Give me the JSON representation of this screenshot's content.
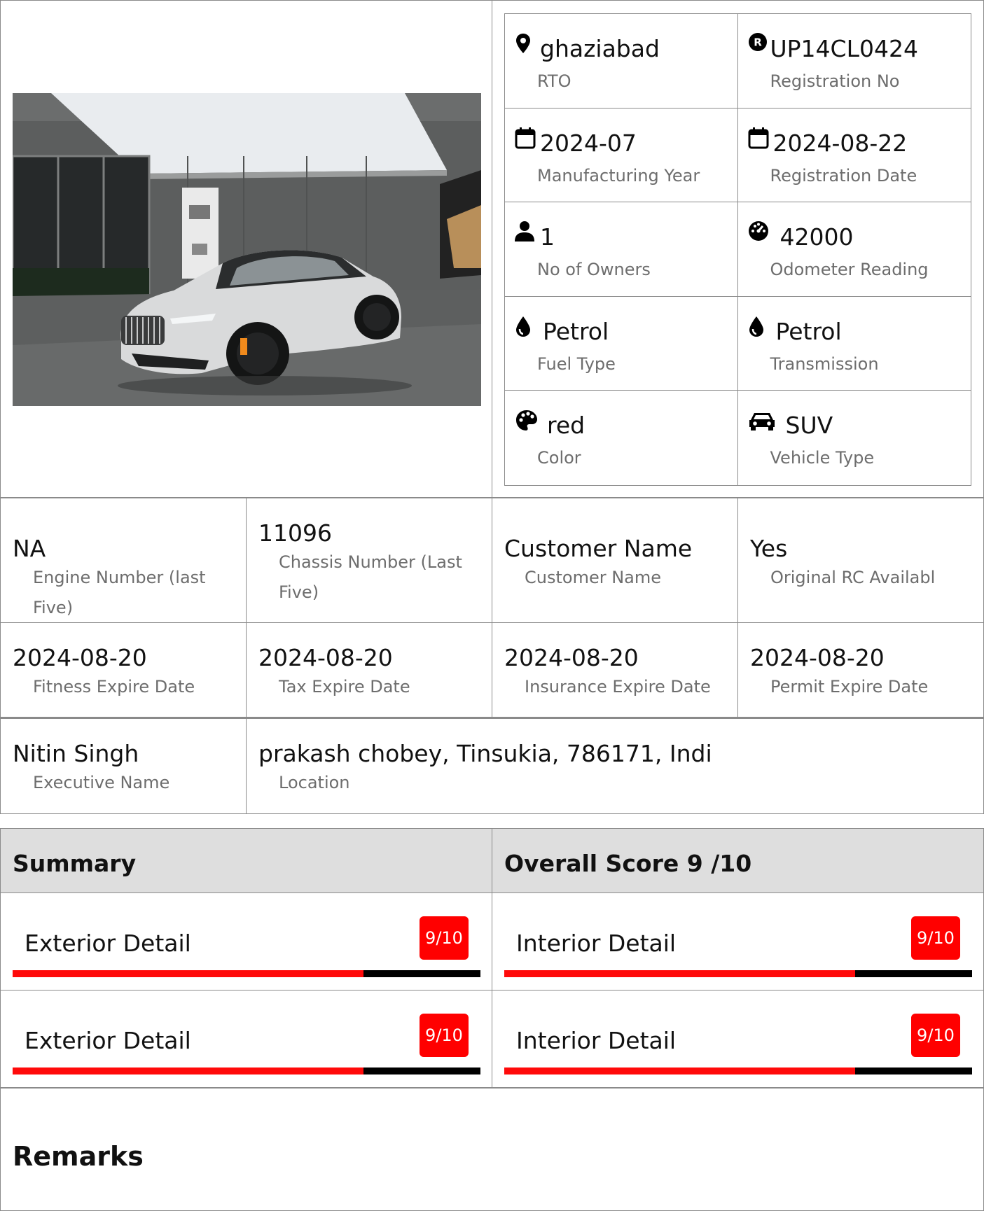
{
  "specs": [
    {
      "icon": "map-pin-icon",
      "value": "ghaziabad",
      "label": "RTO"
    },
    {
      "icon": "registered-icon",
      "value": "UP14CL0424",
      "label": "Registration No"
    },
    {
      "icon": "calendar-icon",
      "value": "2024-07",
      "label": "Manufacturing Year"
    },
    {
      "icon": "calendar-icon",
      "value": "2024-08-22",
      "label": "Registration Date"
    },
    {
      "icon": "user-icon",
      "value": "1",
      "label": "No of Owners"
    },
    {
      "icon": "speedometer-icon",
      "value": "42000",
      "label": "Odometer Reading"
    },
    {
      "icon": "fuel-drop-icon",
      "value": "Petrol",
      "label": "Fuel Type"
    },
    {
      "icon": "fuel-drop-icon",
      "value": "Petrol",
      "label": "Transmission"
    },
    {
      "icon": "palette-icon",
      "value": "red",
      "label": "Color"
    },
    {
      "icon": "car-icon",
      "value": "SUV",
      "label": "Vehicle Type"
    }
  ],
  "details_row1": [
    {
      "value": "NA",
      "label": "Engine Number (last Five)"
    },
    {
      "value": "11096",
      "label": "Chassis Number (Last Five)"
    },
    {
      "value": "Customer Name",
      "label": "Customer Name"
    },
    {
      "value": "Yes",
      "label": "Original RC Availabl"
    }
  ],
  "details_row2": [
    {
      "value": "2024-08-20",
      "label": "Fitness Expire Date"
    },
    {
      "value": "2024-08-20",
      "label": "Tax Expire Date"
    },
    {
      "value": "2024-08-20",
      "label": "Insurance Expire Date"
    },
    {
      "value": "2024-08-20",
      "label": "Permit Expire Date"
    }
  ],
  "details_row3": [
    {
      "value": "Nitin Singh",
      "label": "Executive Name"
    },
    {
      "value": "prakash chobey, Tinsukia, 786171, Indi",
      "label": "Location"
    }
  ],
  "summary": {
    "title": "Summary",
    "overall": "Overall Score 9 /10",
    "scores": [
      {
        "name": "Exterior Detail",
        "score": "9/10",
        "fraction": 0.75
      },
      {
        "name": "Interior Detail",
        "score": "9/10",
        "fraction": 0.75
      },
      {
        "name": "Exterior Detail",
        "score": "9/10",
        "fraction": 0.75
      },
      {
        "name": "Interior Detail",
        "score": "9/10",
        "fraction": 0.75
      }
    ]
  },
  "remarks": {
    "title": "Remarks"
  },
  "colors": {
    "accent": "#ff0000",
    "border": "#8a8a8a",
    "header_bg": "#dedede"
  }
}
